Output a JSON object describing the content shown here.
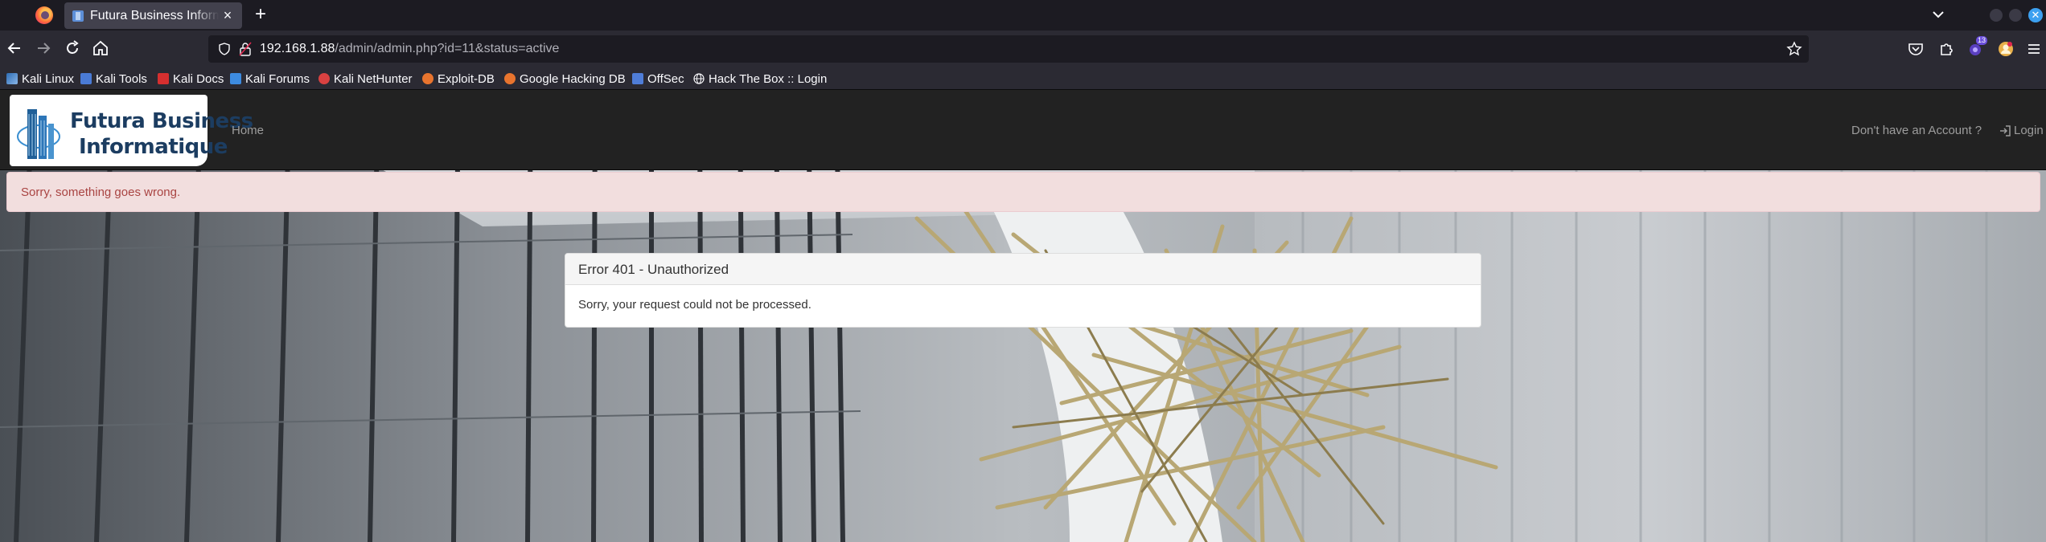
{
  "browser": {
    "tab": {
      "title": "Futura Business Informatique",
      "close": "×"
    },
    "new_tab": "+",
    "url": {
      "host": "192.168.1.88",
      "path": "/admin/admin.php?id=11&status=active"
    },
    "extension_badge": "13",
    "window_close": "✕",
    "bookmarks": [
      {
        "label": "Kali Linux",
        "icon": "kali-dragon-icon",
        "color": "#5b9bd5"
      },
      {
        "label": "Kali Tools",
        "icon": "kali-tools-icon",
        "color": "#4a7bd6"
      },
      {
        "label": "Kali Docs",
        "icon": "kali-docs-icon",
        "color": "#d62f2f"
      },
      {
        "label": "Kali Forums",
        "icon": "kali-forums-icon",
        "color": "#3d8be0"
      },
      {
        "label": "Kali NetHunter",
        "icon": "nethunter-icon",
        "color": "#d94141"
      },
      {
        "label": "Exploit-DB",
        "icon": "exploit-db-icon",
        "color": "#e8742e"
      },
      {
        "label": "Google Hacking DB",
        "icon": "ghdb-icon",
        "color": "#e8742e"
      },
      {
        "label": "OffSec",
        "icon": "offsec-icon",
        "color": "#4f7dd8"
      },
      {
        "label": "Hack The Box :: Login",
        "icon": "globe-icon",
        "color": "#cfcfd8"
      }
    ]
  },
  "site": {
    "brand": {
      "line1": "Futura Business",
      "line2": "Informatique"
    },
    "nav": {
      "home": "Home",
      "account": "Don't have an Account ?",
      "login": "Login"
    },
    "alert": "Sorry, something goes wrong.",
    "panel": {
      "title": "Error 401 - Unauthorized",
      "body": "Sorry, your request could not be processed."
    }
  },
  "colors": {
    "navbar": "#222222",
    "alert_bg": "#f2dede",
    "alert_text": "#a94442",
    "brand_text": "#1c3d61"
  }
}
